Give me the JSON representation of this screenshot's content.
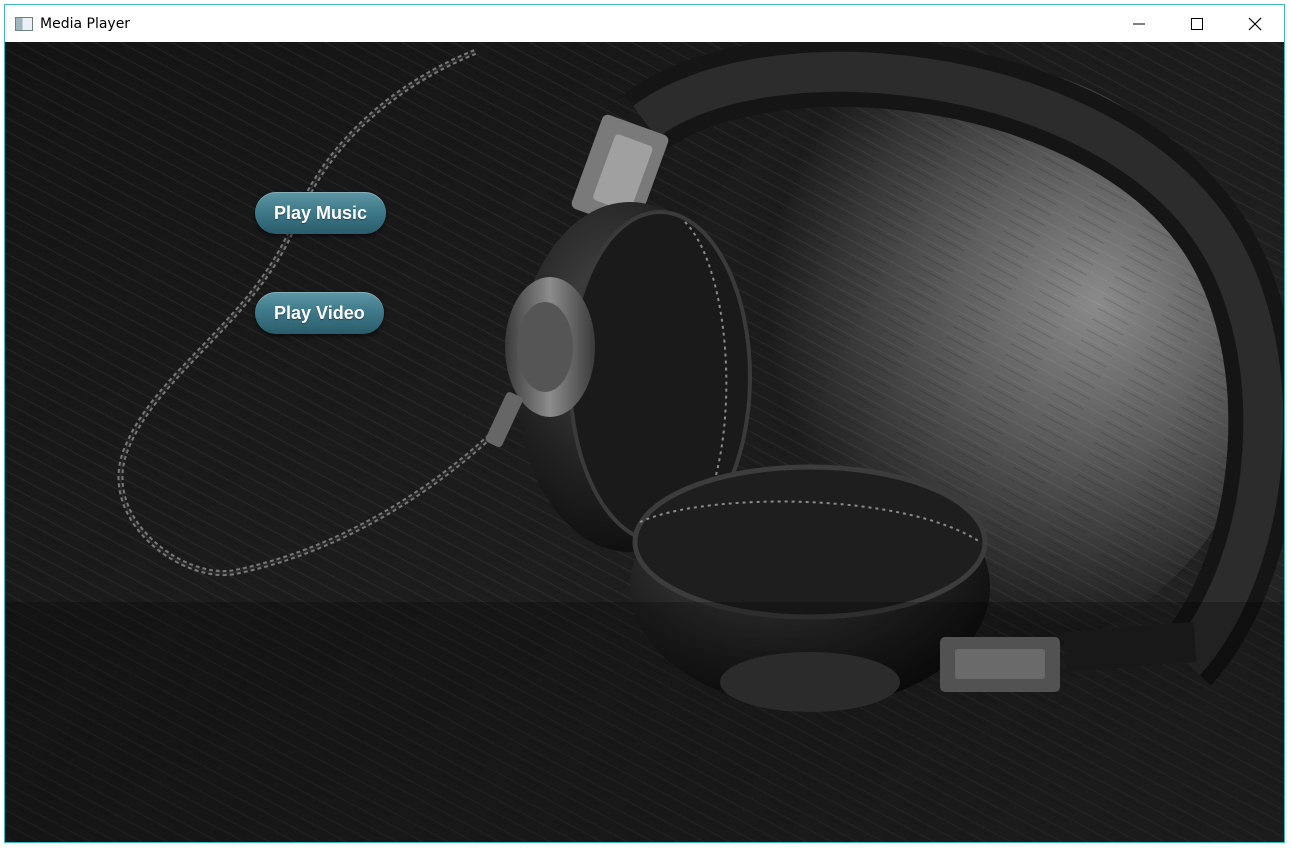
{
  "window": {
    "title": "Media Player",
    "accent_border": "#3fb6c4",
    "controls": [
      "minimize-icon",
      "maximize-icon",
      "close-icon"
    ]
  },
  "background": {
    "image": "headphones-photo",
    "tone": "grayscale"
  },
  "buttons": {
    "play_music_label": "Play Music",
    "play_video_label": "Play Video",
    "color": "#3f7a8a"
  }
}
